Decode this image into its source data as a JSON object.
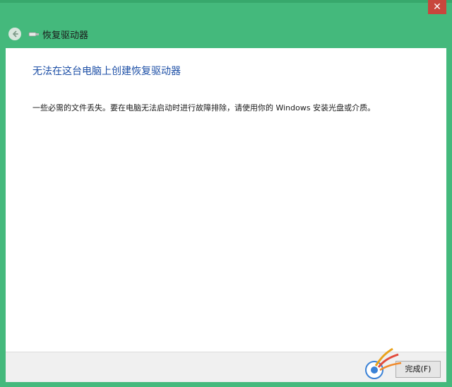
{
  "window": {
    "close_glyph": "✕"
  },
  "nav": {
    "title": "恢复驱动器",
    "back_icon": "back-arrow-icon",
    "drive_icon": "usb-drive-icon"
  },
  "main": {
    "heading": "无法在这台电脑上创建恢复驱动器",
    "message": "一些必需的文件丢失。要在电脑无法启动时进行故障排除，请使用你的 Windows 安装光盘或介质。"
  },
  "footer": {
    "finish_label": "完成(F)"
  },
  "colors": {
    "frame": "#44b97c",
    "heading": "#1d4fa6",
    "close": "#c8463c"
  }
}
